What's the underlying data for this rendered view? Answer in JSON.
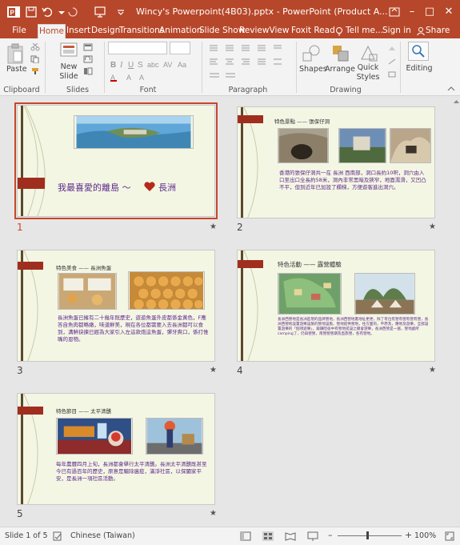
{
  "window": {
    "title": "Wincy's Powerpoint(4B03).pptx - PowerPoint (Product A...",
    "minimize": "–",
    "maximize": "□",
    "close": "✕"
  },
  "tabs": [
    "File",
    "Home",
    "Insert",
    "Design",
    "Transitions",
    "Animation",
    "Slide Show",
    "Review",
    "View",
    "Foxit Read"
  ],
  "tell_me": "Tell me...",
  "sign_in": "Sign in",
  "share": "Share",
  "ribbon": {
    "paste": "Paste",
    "new_slide": "New",
    "new_slide2": "Slide",
    "shapes": "Shapes",
    "arrange": "Arrange",
    "quick": "Quick",
    "styles": "Styles",
    "editing": "Editing",
    "groups": [
      "Clipboard",
      "Slides",
      "Font",
      "Paragraph",
      "Drawing"
    ]
  },
  "slides": [
    {
      "num": "1",
      "title": "我最喜愛的離島 ～",
      "title2": "長洲"
    },
    {
      "num": "2",
      "heading": "特色景點 —— 張保仔洞",
      "text": "香港的張保仔洞共一在 長洲 西南部，洞口長約10呎，洞穴由入口至出口全長約58米，洞內非常黑暗及狹窄，地面濕滑，又凹凸不平，但到近年已加設了欄梯，方便遊客進出洞穴。"
    },
    {
      "num": "3",
      "heading": "特色美食 —— 長洲魚蛋",
      "text": "長洲魚蛋已擁有二十幾年既歷史，遊遊魚蛋外皮都係金黃色，F應答自魚肉都略嫩，味道鮮美，現在各位都需要入去長洲都可以食到，溝鮮抉揀已經為大家引入左這款炮這魚蛋，彈牙爽口，係打惟嘴的恩物。"
    },
    {
      "num": "4",
      "heading": "特色活動 —— 露營體驗",
      "text": "長洲西營地是長洲區現的品牌營地，長洲西營地裏地址更更，除了有位有營有營有營有營，長洲西營地設置遊樂設施的營地設施，營地提供營地，住方面的，平原及，應地及遊樂，全部設置遊樂的「個項遊樂」，鍛鍊陸宿中有營地提設之總會游樂，長洲西營是一遍，營地處所 camping了，仍與營營，南營營營期及直旅營，各有營地。"
    },
    {
      "num": "5",
      "heading": "特色節目 —— 太平清醮",
      "text": "每年農曆四月上旬，長洲都會舉行太平清醮。長洲太平清醮既甚至今已有過百年的歷史，原意是驅除瘟疫，滿淨社區，以保闔家平安，是長洲一項社區活動。"
    }
  ],
  "star": "★",
  "status": {
    "slide_of": "Slide 1 of 5",
    "language": "Chinese (Taiwan)",
    "zoom": "100%",
    "zoom_minus": "–",
    "zoom_plus": "+"
  },
  "colors": {
    "accent": "#b7472a",
    "slide_bg": "#f4f6e4",
    "slide_text": "#5d2a8c",
    "slide_tab": "#a02e1e"
  }
}
